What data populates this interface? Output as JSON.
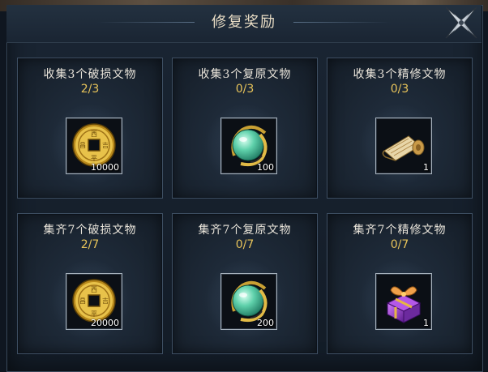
{
  "window": {
    "title": "修复奖励"
  },
  "rewards": [
    {
      "condition": "收集3个破损文物",
      "progress": "2/3",
      "item": {
        "icon": "coin-icon",
        "quantity": "10000"
      }
    },
    {
      "condition": "收集3个复原文物",
      "progress": "0/3",
      "item": {
        "icon": "jade-orb-icon",
        "quantity": "100"
      }
    },
    {
      "condition": "收集3个精修文物",
      "progress": "0/3",
      "item": {
        "icon": "scroll-icon",
        "quantity": "1"
      }
    },
    {
      "condition": "集齐7个破损文物",
      "progress": "2/7",
      "item": {
        "icon": "coin-icon",
        "quantity": "20000"
      }
    },
    {
      "condition": "集齐7个复原文物",
      "progress": "0/7",
      "item": {
        "icon": "jade-orb-icon",
        "quantity": "200"
      }
    },
    {
      "condition": "集齐7个精修文物",
      "progress": "0/7",
      "item": {
        "icon": "purple-giftbox-icon",
        "quantity": "1"
      }
    }
  ],
  "colors": {
    "progress": "#e7c35a",
    "title": "#e8dcc4",
    "panel": "#1a2533"
  }
}
